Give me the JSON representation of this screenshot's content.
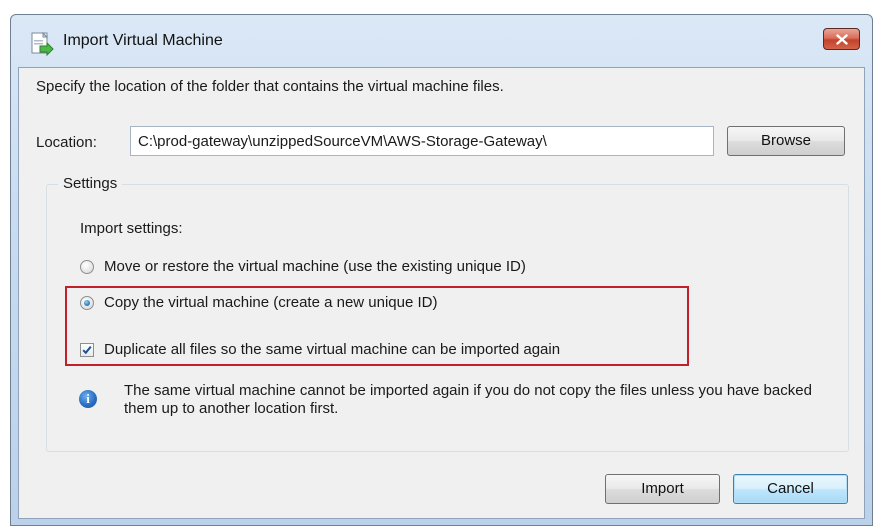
{
  "window": {
    "title": "Import Virtual Machine",
    "title_icon": "import-vm-icon",
    "close_icon": "close-icon"
  },
  "instructions": "Specify the location of the folder that contains the virtual machine files.",
  "location": {
    "label": "Location:",
    "value": "C:\\prod-gateway\\unzippedSourceVM\\AWS-Storage-Gateway\\",
    "browse_label": "Browse"
  },
  "settings": {
    "group_label": "Settings",
    "import_settings_label": "Import settings:",
    "options": [
      {
        "label": "Move or restore the virtual machine (use the existing unique ID)",
        "checked": false
      },
      {
        "label": "Copy the virtual machine (create a new unique ID)",
        "checked": true
      }
    ],
    "duplicate_files": {
      "label": "Duplicate all files so the same virtual machine can be imported again",
      "checked": true
    },
    "info_icon": "info-icon",
    "info_text": "The same virtual machine cannot be imported again if you do not copy the files unless you have backed them up to another location first."
  },
  "buttons": {
    "import_label": "Import",
    "cancel_label": "Cancel"
  },
  "colors": {
    "highlight_border": "#c0202a",
    "titlebar": "#c9dcf0",
    "dialog_background": "#f0f0f0"
  }
}
